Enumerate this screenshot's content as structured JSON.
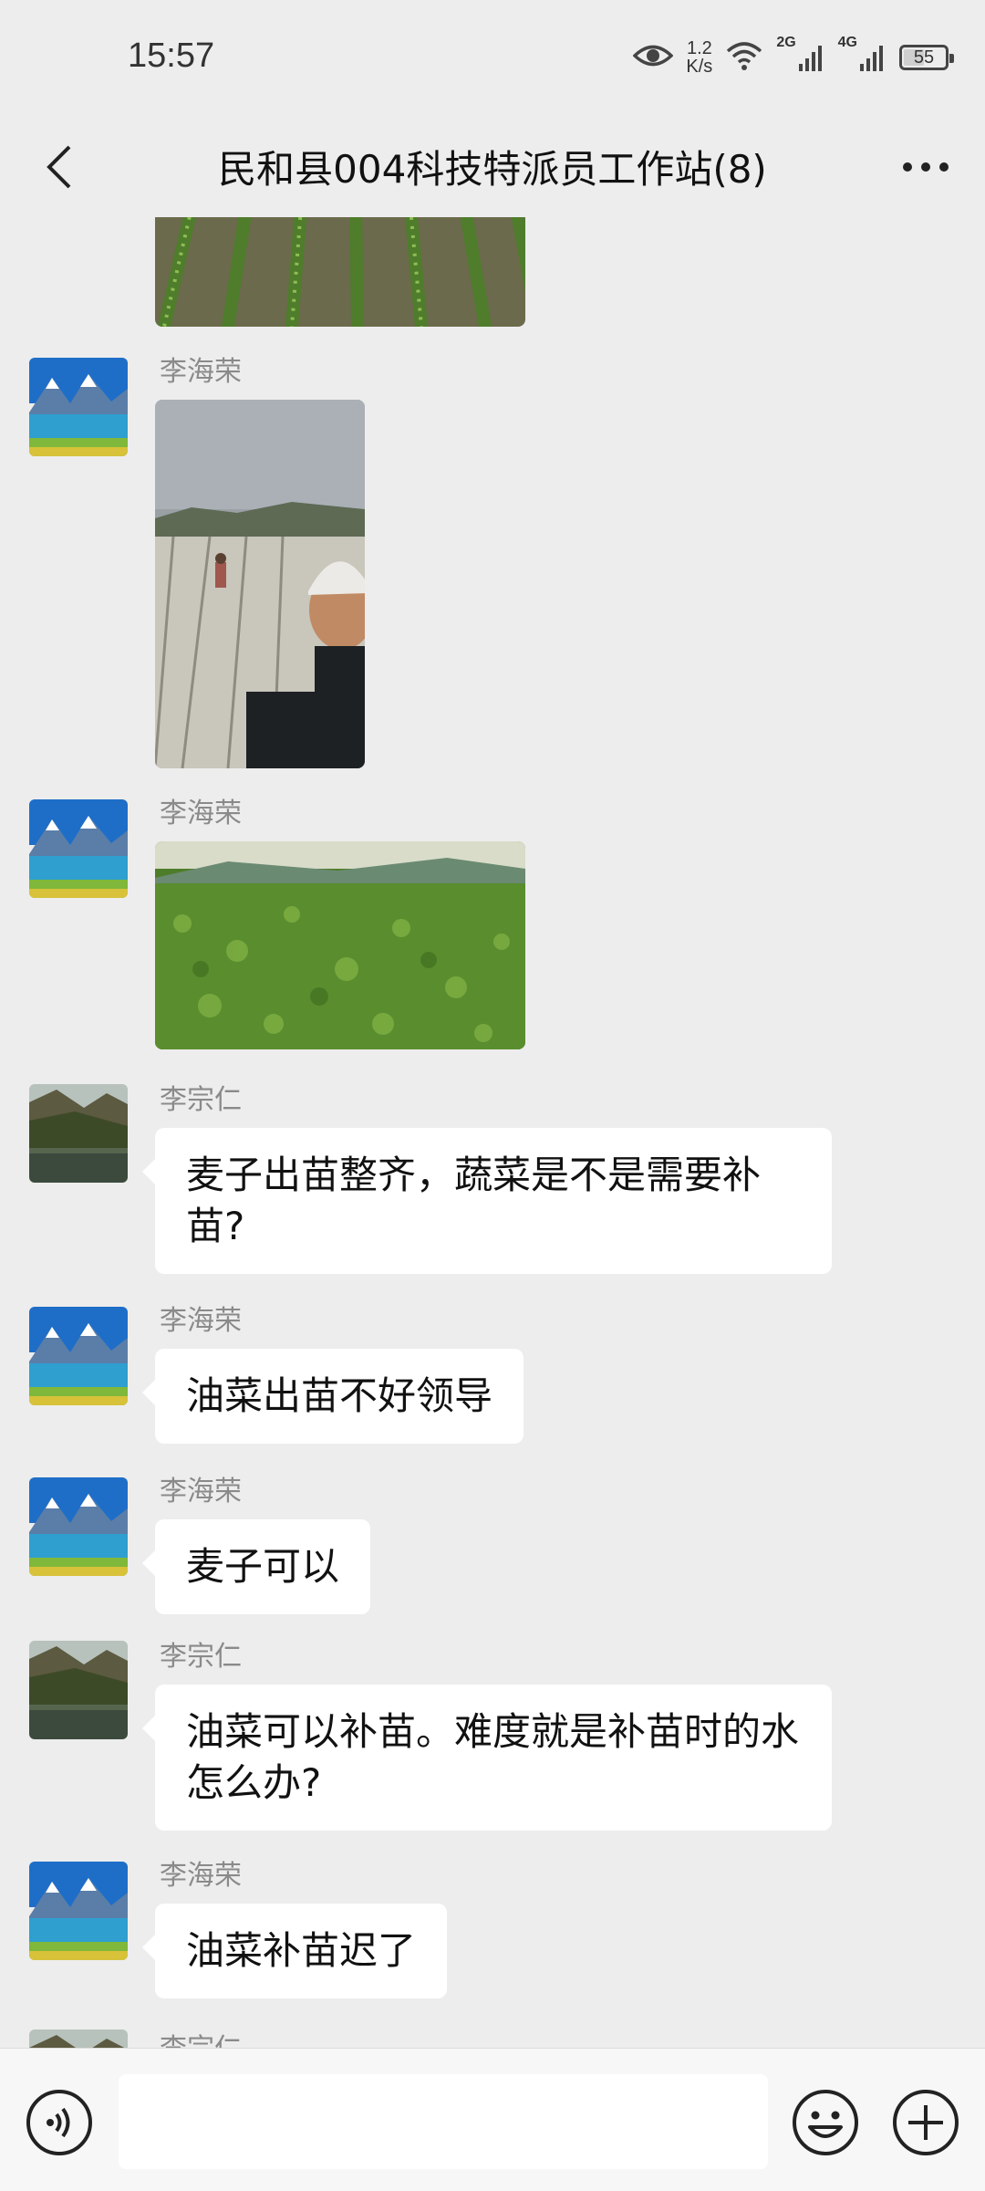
{
  "status_bar": {
    "time": "15:57",
    "net_speed_value": "1.2",
    "net_speed_unit": "K/s",
    "signal1_tag": "2G",
    "signal2_tag": "4G",
    "battery": "55",
    "battery_level": 0.55
  },
  "nav": {
    "title": "民和县004科技特派员工作站(8)"
  },
  "messages": [
    {
      "sender": "",
      "type": "image",
      "image": "wheat-seedling-rows"
    },
    {
      "sender": "李海荣",
      "type": "image",
      "image": "farmer-selfie-field"
    },
    {
      "sender": "李海荣",
      "type": "image",
      "image": "green-crop-field"
    },
    {
      "sender": "李宗仁",
      "type": "text",
      "text": "麦子出苗整齐，蔬菜是不是需要补苗?"
    },
    {
      "sender": "李海荣",
      "type": "text",
      "text": "油菜出苗不好领导"
    },
    {
      "sender": "李海荣",
      "type": "text",
      "text": "麦子可以"
    },
    {
      "sender": "李宗仁",
      "type": "text",
      "text": "油菜可以补苗。难度就是补苗时的水怎么办?"
    },
    {
      "sender": "李海荣",
      "type": "text",
      "text": "油菜补苗迟了"
    },
    {
      "sender": "李宗仁",
      "type": "text",
      "text": ""
    }
  ],
  "input": {
    "value": "",
    "placeholder": ""
  },
  "icons": {
    "back": "chevron-left-icon",
    "more": "more-dots-icon",
    "voice": "voice-icon",
    "emoji": "emoji-icon",
    "plus": "plus-icon"
  },
  "colors": {
    "background": "#ededed",
    "bubble": "#ffffff",
    "sender_name": "#8a8a8a"
  }
}
